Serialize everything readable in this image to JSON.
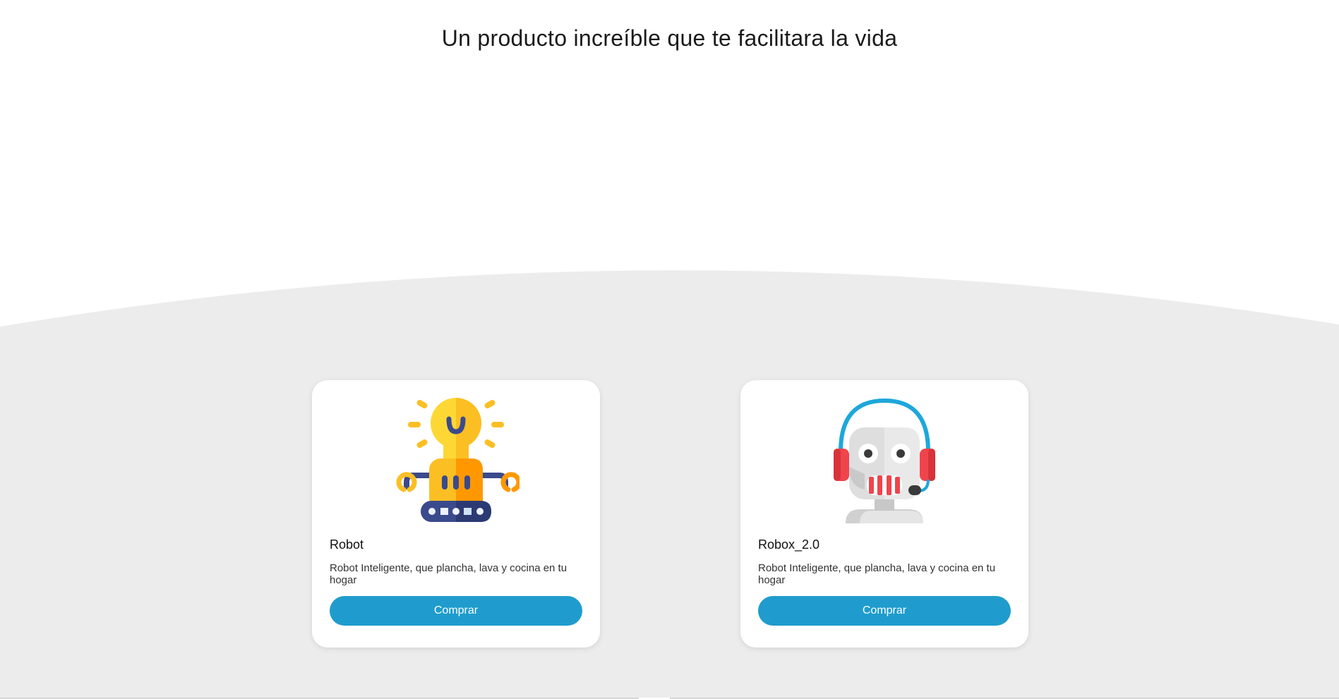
{
  "hero": {
    "title": "Un producto increíble que te facilitara la vida"
  },
  "colors": {
    "background": "#ffffff",
    "section_background": "#ececec",
    "card_background": "#ffffff",
    "button_accent": "#1f9ccd",
    "button_text": "#ffffff"
  },
  "products": [
    {
      "icon": "lightbulb-robot-icon",
      "title": "Robot",
      "description": "Robot Inteligente, que plancha, lava y cocina en tu hogar",
      "button_label": "Comprar"
    },
    {
      "icon": "headset-robot-icon",
      "title": "Robox_2.0",
      "description": "Robot Inteligente, que plancha, lava y cocina en tu hogar",
      "button_label": "Comprar"
    }
  ]
}
